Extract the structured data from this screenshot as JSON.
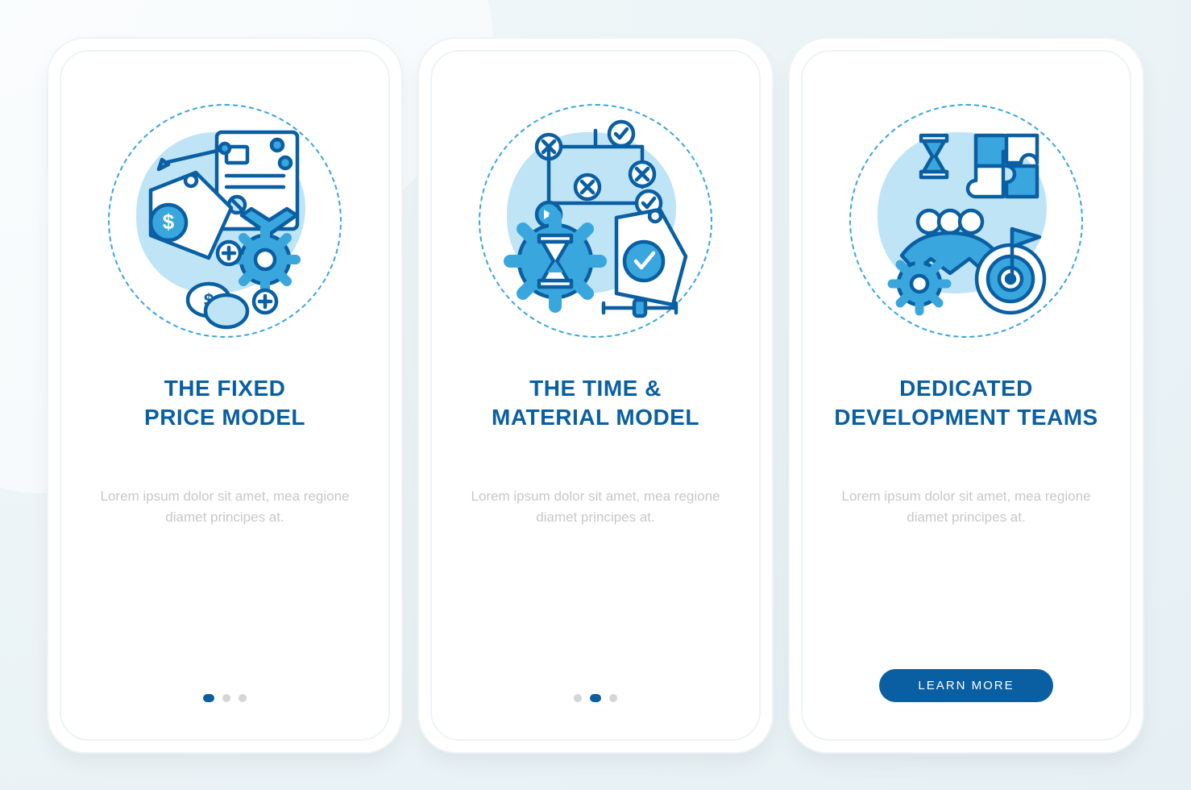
{
  "screens": [
    {
      "title_line1": "THE FIXED",
      "title_line2": "PRICE MODEL",
      "body": "Lorem ipsum dolor sit amet, mea regione diamet principes at.",
      "icon": "fixed-price-icon",
      "nav": "dots",
      "active_dot": 0
    },
    {
      "title_line1": "THE TIME &",
      "title_line2": "MATERIAL MODEL",
      "body": "Lorem ipsum dolor sit amet, mea regione diamet principes at.",
      "icon": "time-material-icon",
      "nav": "dots",
      "active_dot": 1
    },
    {
      "title_line1": "DEDICATED",
      "title_line2": "DEVELOPMENT TEAMS",
      "body": "Lorem ipsum dolor sit amet, mea regione diamet principes at.",
      "icon": "dedicated-teams-icon",
      "nav": "button",
      "button_label": "LEARN MORE"
    }
  ],
  "colors": {
    "accent": "#0a5fa3",
    "icon_stroke": "#0a5fa3",
    "icon_fill": "#3aa6de",
    "light_fill": "#bfe4f6"
  }
}
